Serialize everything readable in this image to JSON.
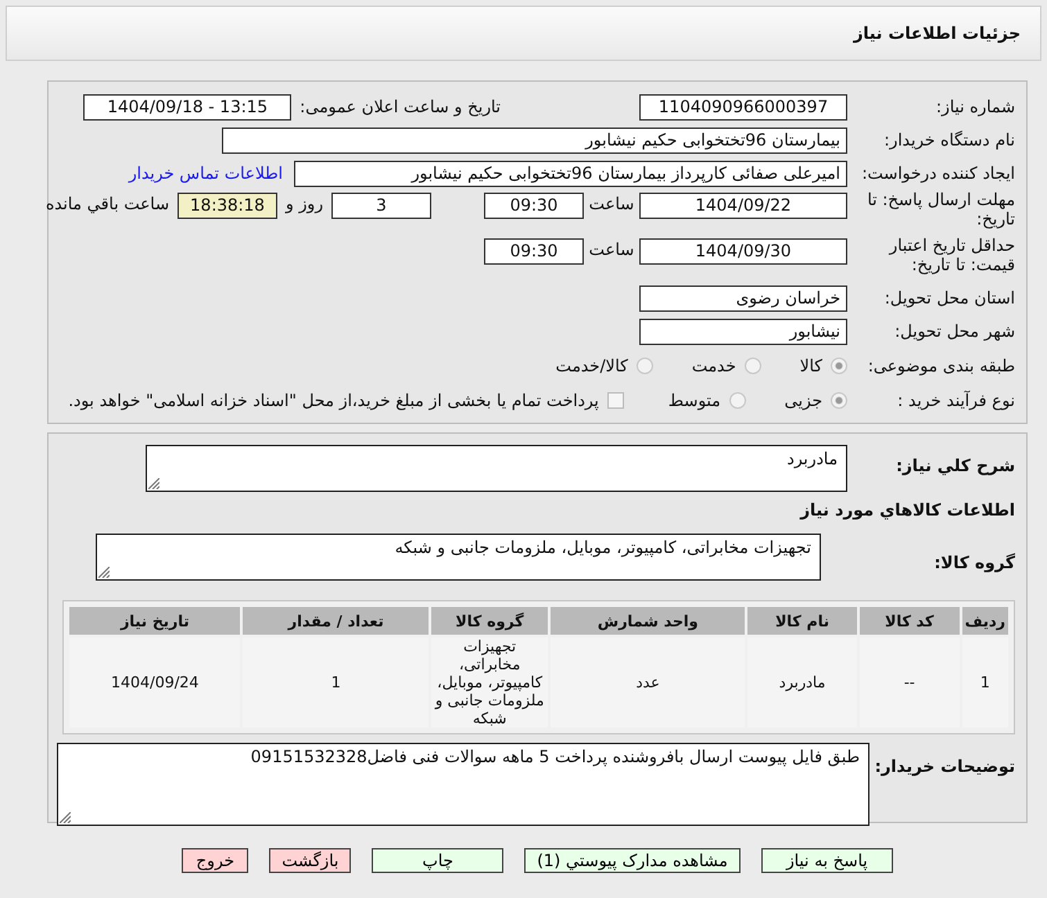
{
  "header": {
    "title": "جزئیات اطلاعات نیاز"
  },
  "need_number": {
    "label": "شماره نیاز:",
    "value": "1104090966000397"
  },
  "announce": {
    "label": "تاریخ و ساعت اعلان عمومی:",
    "value": "1404/09/18 - 13:15"
  },
  "buyer_org": {
    "label": "نام دستگاه خریدار:",
    "value": "بیمارستان 96تختخوابی حکیم نیشابور"
  },
  "creator": {
    "label": "ایجاد کننده درخواست:",
    "value": "امیرعلی صفائی کارپرداز بیمارستان 96تختخوابی حکیم نیشابور",
    "link": "اطلاعات تماس خریدار"
  },
  "deadline": {
    "label": "مهلت ارسال پاسخ: تا تاریخ:",
    "date": "1404/09/22",
    "time_label": "ساعت",
    "time": "09:30",
    "days": "3",
    "days_label": "روز و",
    "remaining": "18:38:18",
    "remaining_label": "ساعت باقي مانده"
  },
  "validity": {
    "label": "حداقل تاریخ اعتبار قیمت: تا تاریخ:",
    "date": "1404/09/30",
    "time_label": "ساعت",
    "time": "09:30"
  },
  "province": {
    "label": "استان محل تحویل:",
    "value": "خراسان رضوی"
  },
  "city": {
    "label": "شهر محل تحویل:",
    "value": "نیشابور"
  },
  "category": {
    "label": "طبقه بندی موضوعی:",
    "options": [
      {
        "label": "کالا",
        "selected": true
      },
      {
        "label": "خدمت",
        "selected": false
      },
      {
        "label": "کالا/خدمت",
        "selected": false
      }
    ]
  },
  "purchase_type": {
    "label": "نوع فرآیند خرید :",
    "options": [
      {
        "label": "جزیی",
        "selected": true
      },
      {
        "label": "متوسط",
        "selected": false
      }
    ],
    "checkbox": {
      "label": "پرداخت تمام یا بخشی از مبلغ خرید،از محل \"اسناد خزانه اسلامی\" خواهد بود.",
      "checked": false
    }
  },
  "description": {
    "label": "شرح کلي نياز:",
    "value": "مادربرد"
  },
  "goods_title": "اطلاعات کالاهاي مورد نياز",
  "goods_group": {
    "label": "گروه کالا:",
    "value": "تجهیزات مخابراتی، کامپیوتر، موبایل، ملزومات جانبی و شبکه"
  },
  "table": {
    "columns": [
      "رديف",
      "کد کالا",
      "نام کالا",
      "واحد شمارش",
      "گروه کالا",
      "تعداد / مقدار",
      "تاریخ نیاز"
    ],
    "rows": [
      [
        "1",
        "--",
        "مادربرد",
        "عدد",
        "تجهیزات مخابراتی، کامپیوتر، موبایل، ملزومات جانبی و شبکه",
        "1",
        "1404/09/24"
      ]
    ]
  },
  "notes": {
    "label": "توضیحات خریدار:",
    "value": "طبق فایل پیوست ارسال بافروشنده پرداخت 5 ماهه سوالات فنی فاضل09151532328"
  },
  "buttons": [
    {
      "label": "پاسخ به نیاز",
      "kind": "action"
    },
    {
      "label": "مشاهده مدارک پیوستي (1)",
      "kind": "action"
    },
    {
      "label": "چاپ",
      "kind": "action"
    },
    {
      "label": "بازگشت",
      "kind": "exit"
    },
    {
      "label": "خروج",
      "kind": "exit"
    }
  ]
}
